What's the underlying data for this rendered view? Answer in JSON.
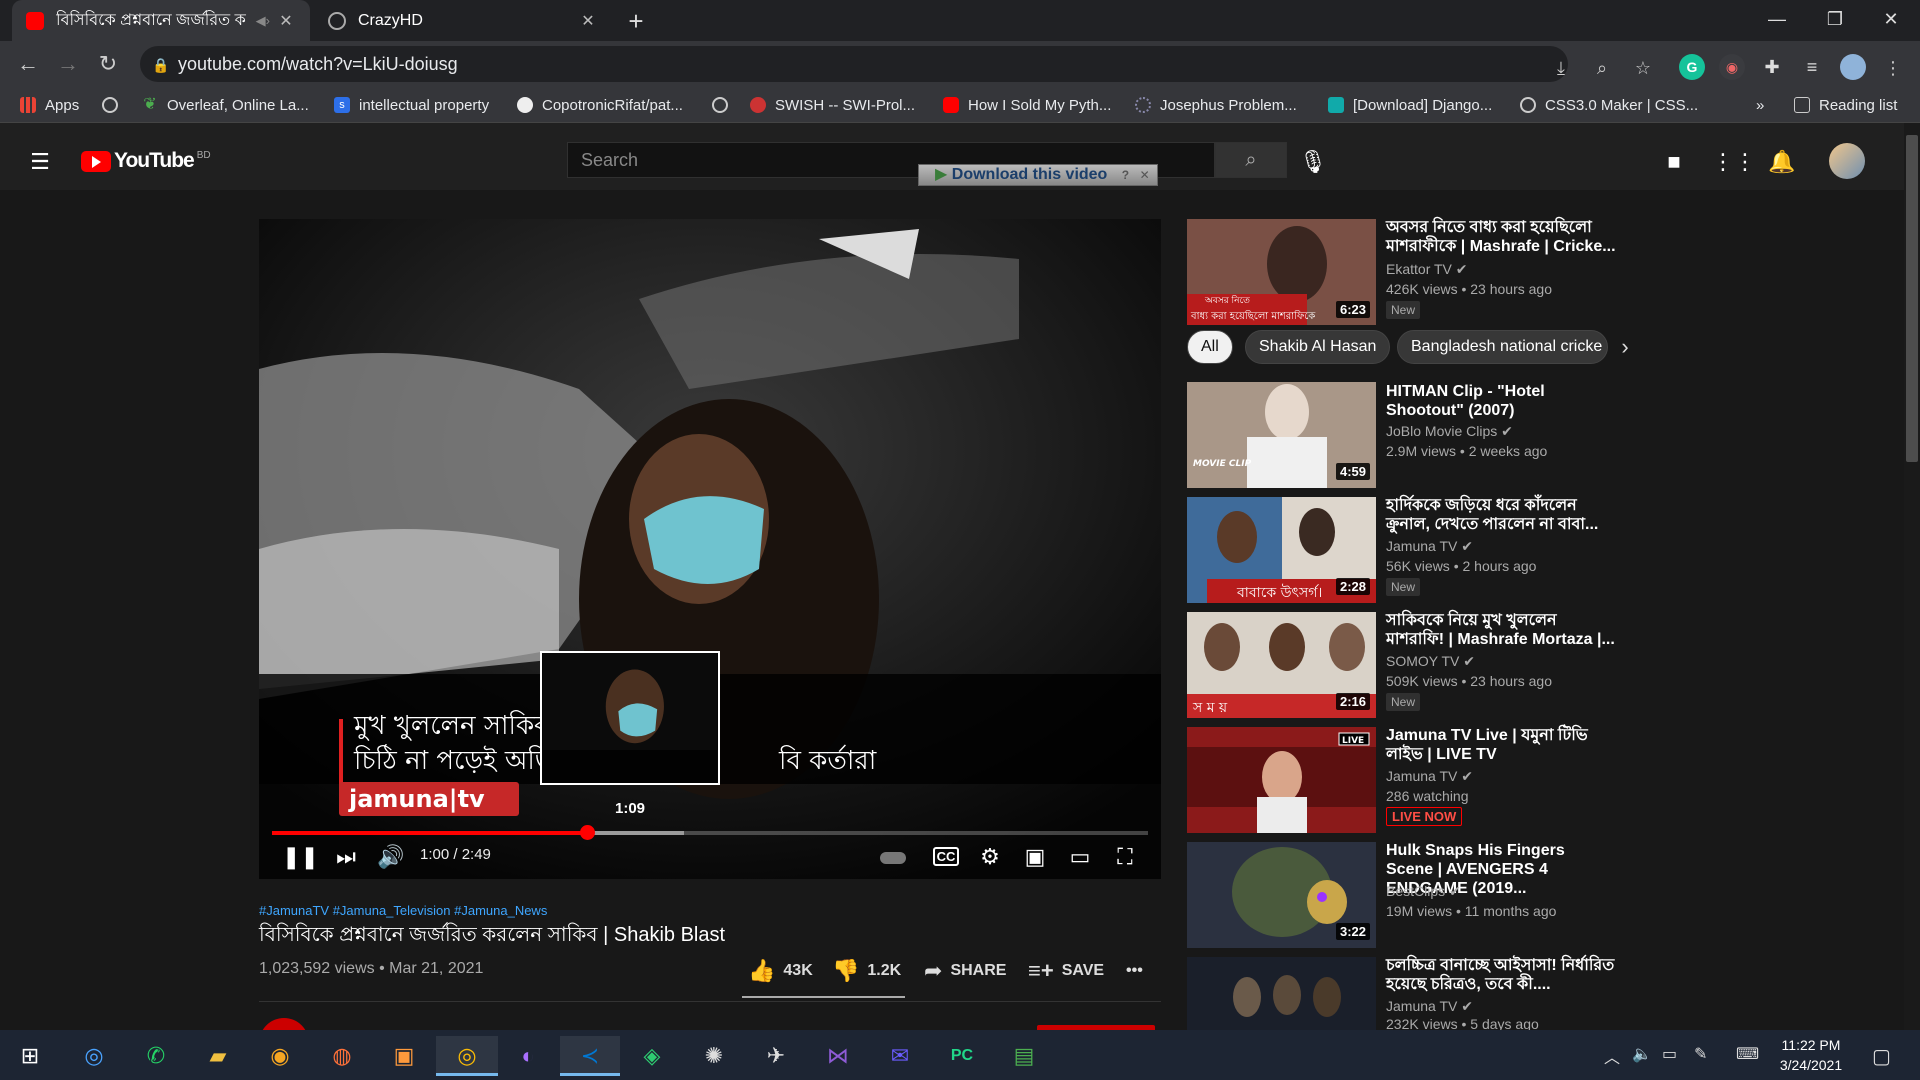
{
  "browser": {
    "tabs": [
      {
        "title": "বিসিবিকে প্রশ্নবানে জর্জরিত ক",
        "active": true
      },
      {
        "title": "CrazyHD",
        "active": false
      }
    ],
    "url": "youtube.com/watch?v=LkiU-doiusg",
    "bookmarks": [
      "Apps",
      "Overleaf, Online La...",
      "intellectual property",
      "CopotronicRifat/pat...",
      "SWISH -- SWI-Prol...",
      "How I Sold My Pyth...",
      "Josephus Problem...",
      "[Download] Django...",
      "CSS3.0 Maker | CSS..."
    ],
    "reading_list": "Reading list",
    "more_bookmarks": "»"
  },
  "youtube": {
    "logo_text": "YouTube",
    "country_code": "BD",
    "search_placeholder": "Search",
    "download_bar": "Download this video",
    "player": {
      "progress": 0.36,
      "buffered": 0.47,
      "hover_time": "1:09",
      "time": "1:00 / 2:49",
      "overlay_line1": "মুখ খুললেন সাকিব",
      "overlay_line2": "চিঠি না পড়েই অভি",
      "overlay_line3": "বি কর্তারা",
      "watermark": "jamuna|tv"
    },
    "video": {
      "hashtags": "#JamunaTV #Jamuna_Television #Jamuna_News",
      "title": "বিসিবিকে প্রশ্নবানে জর্জরিত করলেন সাকিব | Shakib Blast",
      "meta": "1,023,592 views • Mar 21, 2021",
      "likes": "43K",
      "dislikes": "1.2K",
      "share": "SHARE",
      "save": "SAVE",
      "more": "•••"
    },
    "chips": [
      "All",
      "Shakib Al Hasan",
      "Bangladesh national cricke"
    ],
    "first_card": {
      "title": "অবসর নিতে বাধ্য করা হয়েছিলো মাশরাফীকে | Mashrafe | Cricke...",
      "channel": "Ekattor TV",
      "stats": "426K views • 23 hours ago",
      "badge": "New",
      "duration": "6:23"
    },
    "recommendations": [
      {
        "title": "HITMAN Clip - \"Hotel Shootout\" (2007)",
        "channel": "JoBlo Movie Clips",
        "stats": "2.9M views • 2 weeks ago",
        "badge": "",
        "duration": "4:59"
      },
      {
        "title": "হার্দিককে জড়িয়ে ধরে কাঁদলেন ক্রুনাল, দেখতে পারলেন না বাবা...",
        "channel": "Jamuna TV",
        "stats": "56K views • 2 hours ago",
        "badge": "New",
        "duration": "2:28"
      },
      {
        "title": "সাকিবকে নিয়ে মুখ খুললেন মাশরাফি! | Mashrafe Mortaza |...",
        "channel": "SOMOY TV",
        "stats": "509K views • 23 hours ago",
        "badge": "New",
        "duration": "2:16"
      },
      {
        "title": "Jamuna TV Live | যমুনা টিভি লাইভ | LIVE TV",
        "channel": "Jamuna TV",
        "stats": "286 watching",
        "badge": "LIVE NOW",
        "duration": ""
      },
      {
        "title": "Hulk Snaps His Fingers Scene | AVENGERS 4 ENDGAME (2019...",
        "channel": "BestClips",
        "stats": "19M views • 11 months ago",
        "badge": "",
        "duration": "3:22"
      },
      {
        "title": "চলচ্চিত্র বানাচ্ছে আইসাসা! নির্ধারিত হয়েছে চরিত্রও, তবে কী....",
        "channel": "Jamuna TV",
        "stats": "232K views • 5 days ago",
        "badge": "",
        "duration": ""
      }
    ],
    "thumb_texts": {
      "t0": "বাধ্য করা হয়েছিলো মাশরাফিকে",
      "t0b": "অবসর নিতে",
      "t1": "MOVIE CLIP",
      "t2": "বাবাকে উৎসর্গ।",
      "t3": "স ম য়",
      "t4": "LIVE"
    }
  },
  "taskbar": {
    "time": "11:22 PM",
    "date": "3/24/2021"
  },
  "colors": {
    "youtube_red": "#ff0000",
    "background": "#181818",
    "link_blue": "#3ea6ff"
  }
}
